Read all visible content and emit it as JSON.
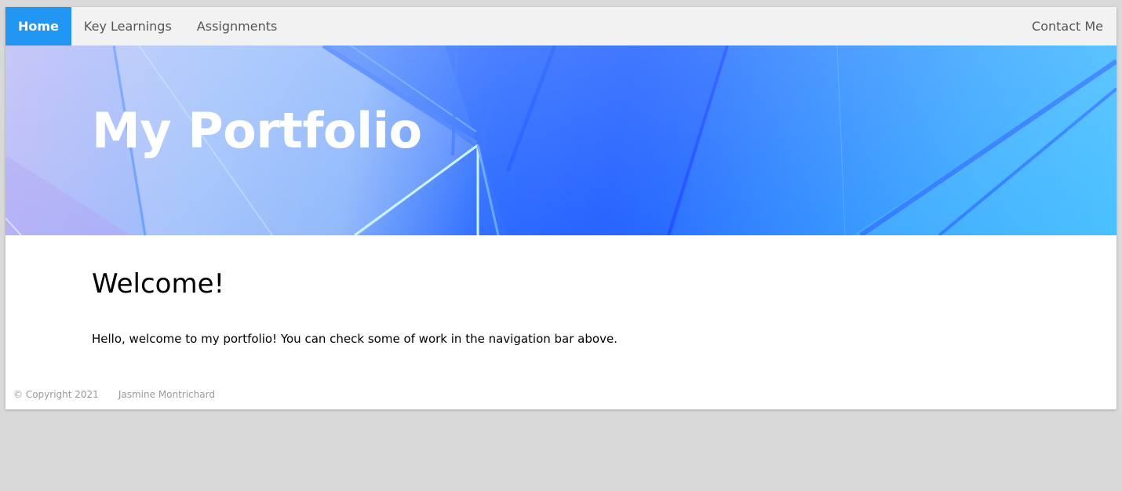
{
  "navbar": {
    "items": [
      {
        "label": "Home",
        "active": true
      },
      {
        "label": "Key Learnings",
        "active": false
      },
      {
        "label": "Assignments",
        "active": false
      }
    ],
    "contact_label": "Contact Me",
    "active_color": "#2196f3",
    "background_color": "#f2f2f2"
  },
  "hero": {
    "title": "My Portfolio"
  },
  "main": {
    "heading": "Welcome!",
    "paragraph": "Hello, welcome to my portfolio! You can check some of work in the navigation bar above."
  },
  "footer": {
    "copyright": "© Copyright 2021",
    "author": "Jasmine Montrichard"
  }
}
